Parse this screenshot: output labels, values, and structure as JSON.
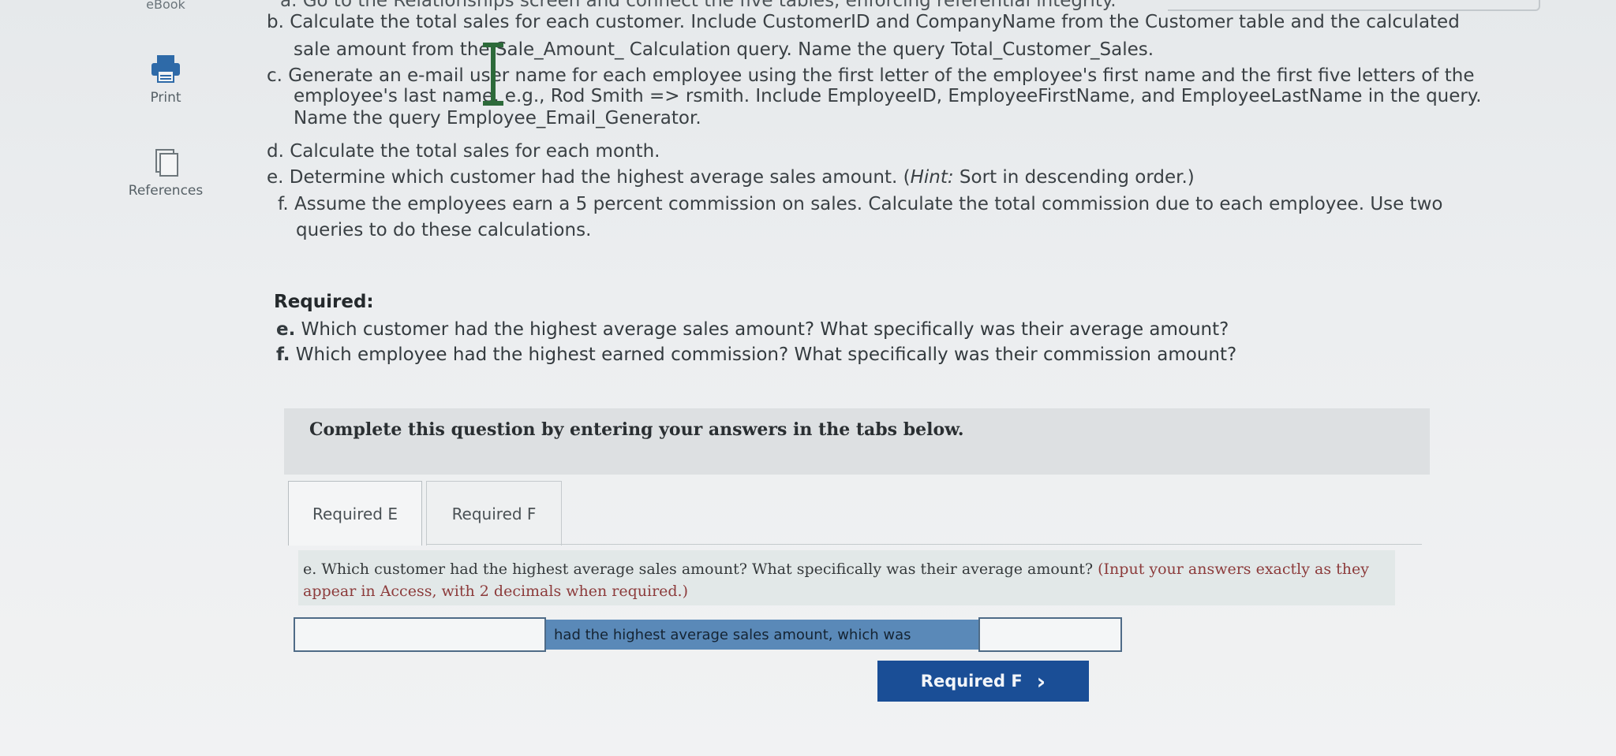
{
  "rail": {
    "ebook_label": "eBook",
    "print_label": "Print",
    "references_label": "References"
  },
  "instructions": {
    "line_a_cut": "a. Go to the Relationships screen and connect the five tables, enforcing referential integrity.",
    "line_b1": "b. Calculate the total sales for each customer. Include CustomerID and CompanyName from the Customer table and the calculated",
    "line_b2": "sale amount from the Sale_Amount_ Calculation query. Name the query Total_Customer_Sales.",
    "line_c1": "c. Generate an e-mail user name for each employee using the first letter of the employee's first name and the first five letters of the",
    "line_c2": "employee's last name, e.g., Rod Smith => rsmith. Include EmployeeID, EmployeeFirstName, and EmployeeLastName in the query.",
    "line_c3": "Name the query Employee_Email_Generator.",
    "line_d": "d. Calculate the total sales for each month.",
    "line_e_pre": "e. Determine which customer had the highest average sales amount. (",
    "line_e_hint": "Hint:",
    "line_e_post": " Sort in descending order.)",
    "line_f1": "f. Assume the employees earn a 5 percent commission on sales. Calculate the total commission due to each employee. Use two",
    "line_f2": "queries to do these calculations."
  },
  "required": {
    "title": "Required:",
    "e_letter": "e.",
    "e_text": " Which customer had the highest average sales amount? What specifically was their average amount?",
    "f_letter": "f.",
    "f_text": " Which employee had the highest earned commission? What specifically was their commission amount?"
  },
  "panel": {
    "heading": "Complete this question by entering your answers in the tabs below."
  },
  "tabs": [
    {
      "label": "Required E",
      "active": true
    },
    {
      "label": "Required F",
      "active": false
    }
  ],
  "question": {
    "text": "e. Which customer had the highest average sales amount? What specifically was their average amount?",
    "hint": " (Input your answers exactly as they appear in Access, with 2 decimals when required.)"
  },
  "answer": {
    "customer_value": "",
    "middle_label": "had the highest average sales amount, which was",
    "amount_value": ""
  },
  "next_button": {
    "label": "Required F",
    "chevron": "›"
  },
  "colors": {
    "primary_button": "#1a4e96",
    "label_fill": "#5a89b8",
    "hint_text": "#8c3b3b"
  }
}
